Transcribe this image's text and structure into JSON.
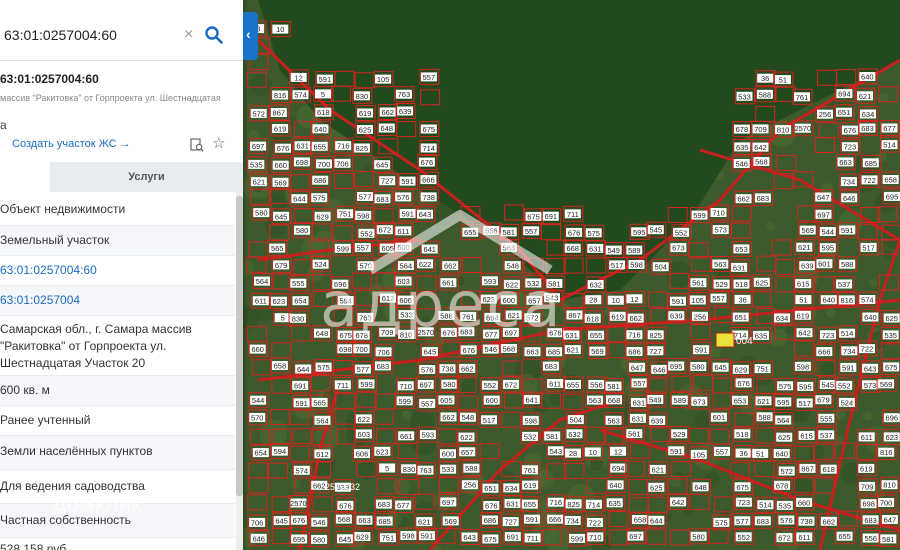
{
  "search": {
    "value": "63:01:0257004:60",
    "clear_icon": "×",
    "search_icon": "search-icon"
  },
  "panel": {
    "collapse_icon": "‹",
    "title": "63:01:0257004:60",
    "address_short": "массив \"Ракитовка\" от Горпроекта ул. Шестнадцатая",
    "letter": "а",
    "create_link": "Создать участок ЖС →",
    "star_icon": "☆",
    "tab_services": "Услуги",
    "rows": [
      {
        "text": "Объект недвижимости"
      },
      {
        "text": "Земельный участок"
      },
      {
        "text": "63:01:0257004:60"
      },
      {
        "text": "63:01:0257004"
      },
      {
        "text": "Самарская обл., г. Самара массив \"Ракитовка\" от Горпроекта ул. Шестнадцатая Участок 20"
      },
      {
        "text": "600 кв. м"
      },
      {
        "text": "Ранее учтенный"
      },
      {
        "text": "Земли населённых пунктов"
      },
      {
        "text": "Для ведения садоводства"
      },
      {
        "text": "Частная собственность"
      },
      {
        "text": "528 158 руб."
      }
    ]
  },
  "watermarks": {
    "domclick": "Домклик",
    "adresa": "адреса"
  },
  "map": {
    "parcel_labels": [
      "28",
      "10",
      "12",
      "591",
      "105",
      "557",
      "36",
      "51",
      "640",
      "816",
      "574",
      "5",
      "830",
      "763",
      "533",
      "588",
      "761",
      "694",
      "621",
      "572",
      "867",
      "618",
      "619",
      "662",
      "639",
      "256",
      "651",
      "634",
      "619",
      "640",
      "625",
      "648",
      "675",
      "678",
      "709",
      "810",
      "2570",
      "676",
      "683",
      "677",
      "697",
      "676",
      "631",
      "655",
      "716",
      "825",
      "714",
      "635",
      "642",
      "723",
      "514",
      "535",
      "660",
      "698",
      "700",
      "706",
      "645",
      "676",
      "546",
      "568",
      "663",
      "685",
      "621",
      "569",
      "686",
      "727",
      "591",
      "666",
      "734",
      "722",
      "658",
      "644",
      "575",
      "577",
      "683",
      "576",
      "738",
      "662",
      "683",
      "647",
      "646",
      "695",
      "580",
      "645",
      "629",
      "751",
      "598",
      "591",
      "643",
      "675",
      "691",
      "711",
      "599",
      "710",
      "697",
      "580",
      "552",
      "672",
      "611",
      "655",
      "556",
      "581",
      "557",
      "676",
      "575",
      "595",
      "545",
      "552",
      "573",
      "569",
      "544",
      "591",
      "565",
      "599",
      "557",
      "605",
      "600",
      "641",
      "563",
      "668",
      "631",
      "549",
      "589",
      "673",
      "653",
      "621",
      "595",
      "517",
      "679",
      "524",
      "570",
      "564",
      "622",
      "662",
      "548",
      "517",
      "598",
      "504",
      "563",
      "631",
      "639",
      "601",
      "588",
      "564",
      "555",
      "696",
      "603",
      "661",
      "593",
      "622",
      "532",
      "581",
      "632",
      "561",
      "529",
      "518",
      "625",
      "615",
      "537",
      "611",
      "623",
      "654",
      "594",
      "612",
      "606",
      "623",
      "600",
      "657",
      "543"
    ],
    "selected_label": "004",
    "overlay_label": "2570032"
  }
}
